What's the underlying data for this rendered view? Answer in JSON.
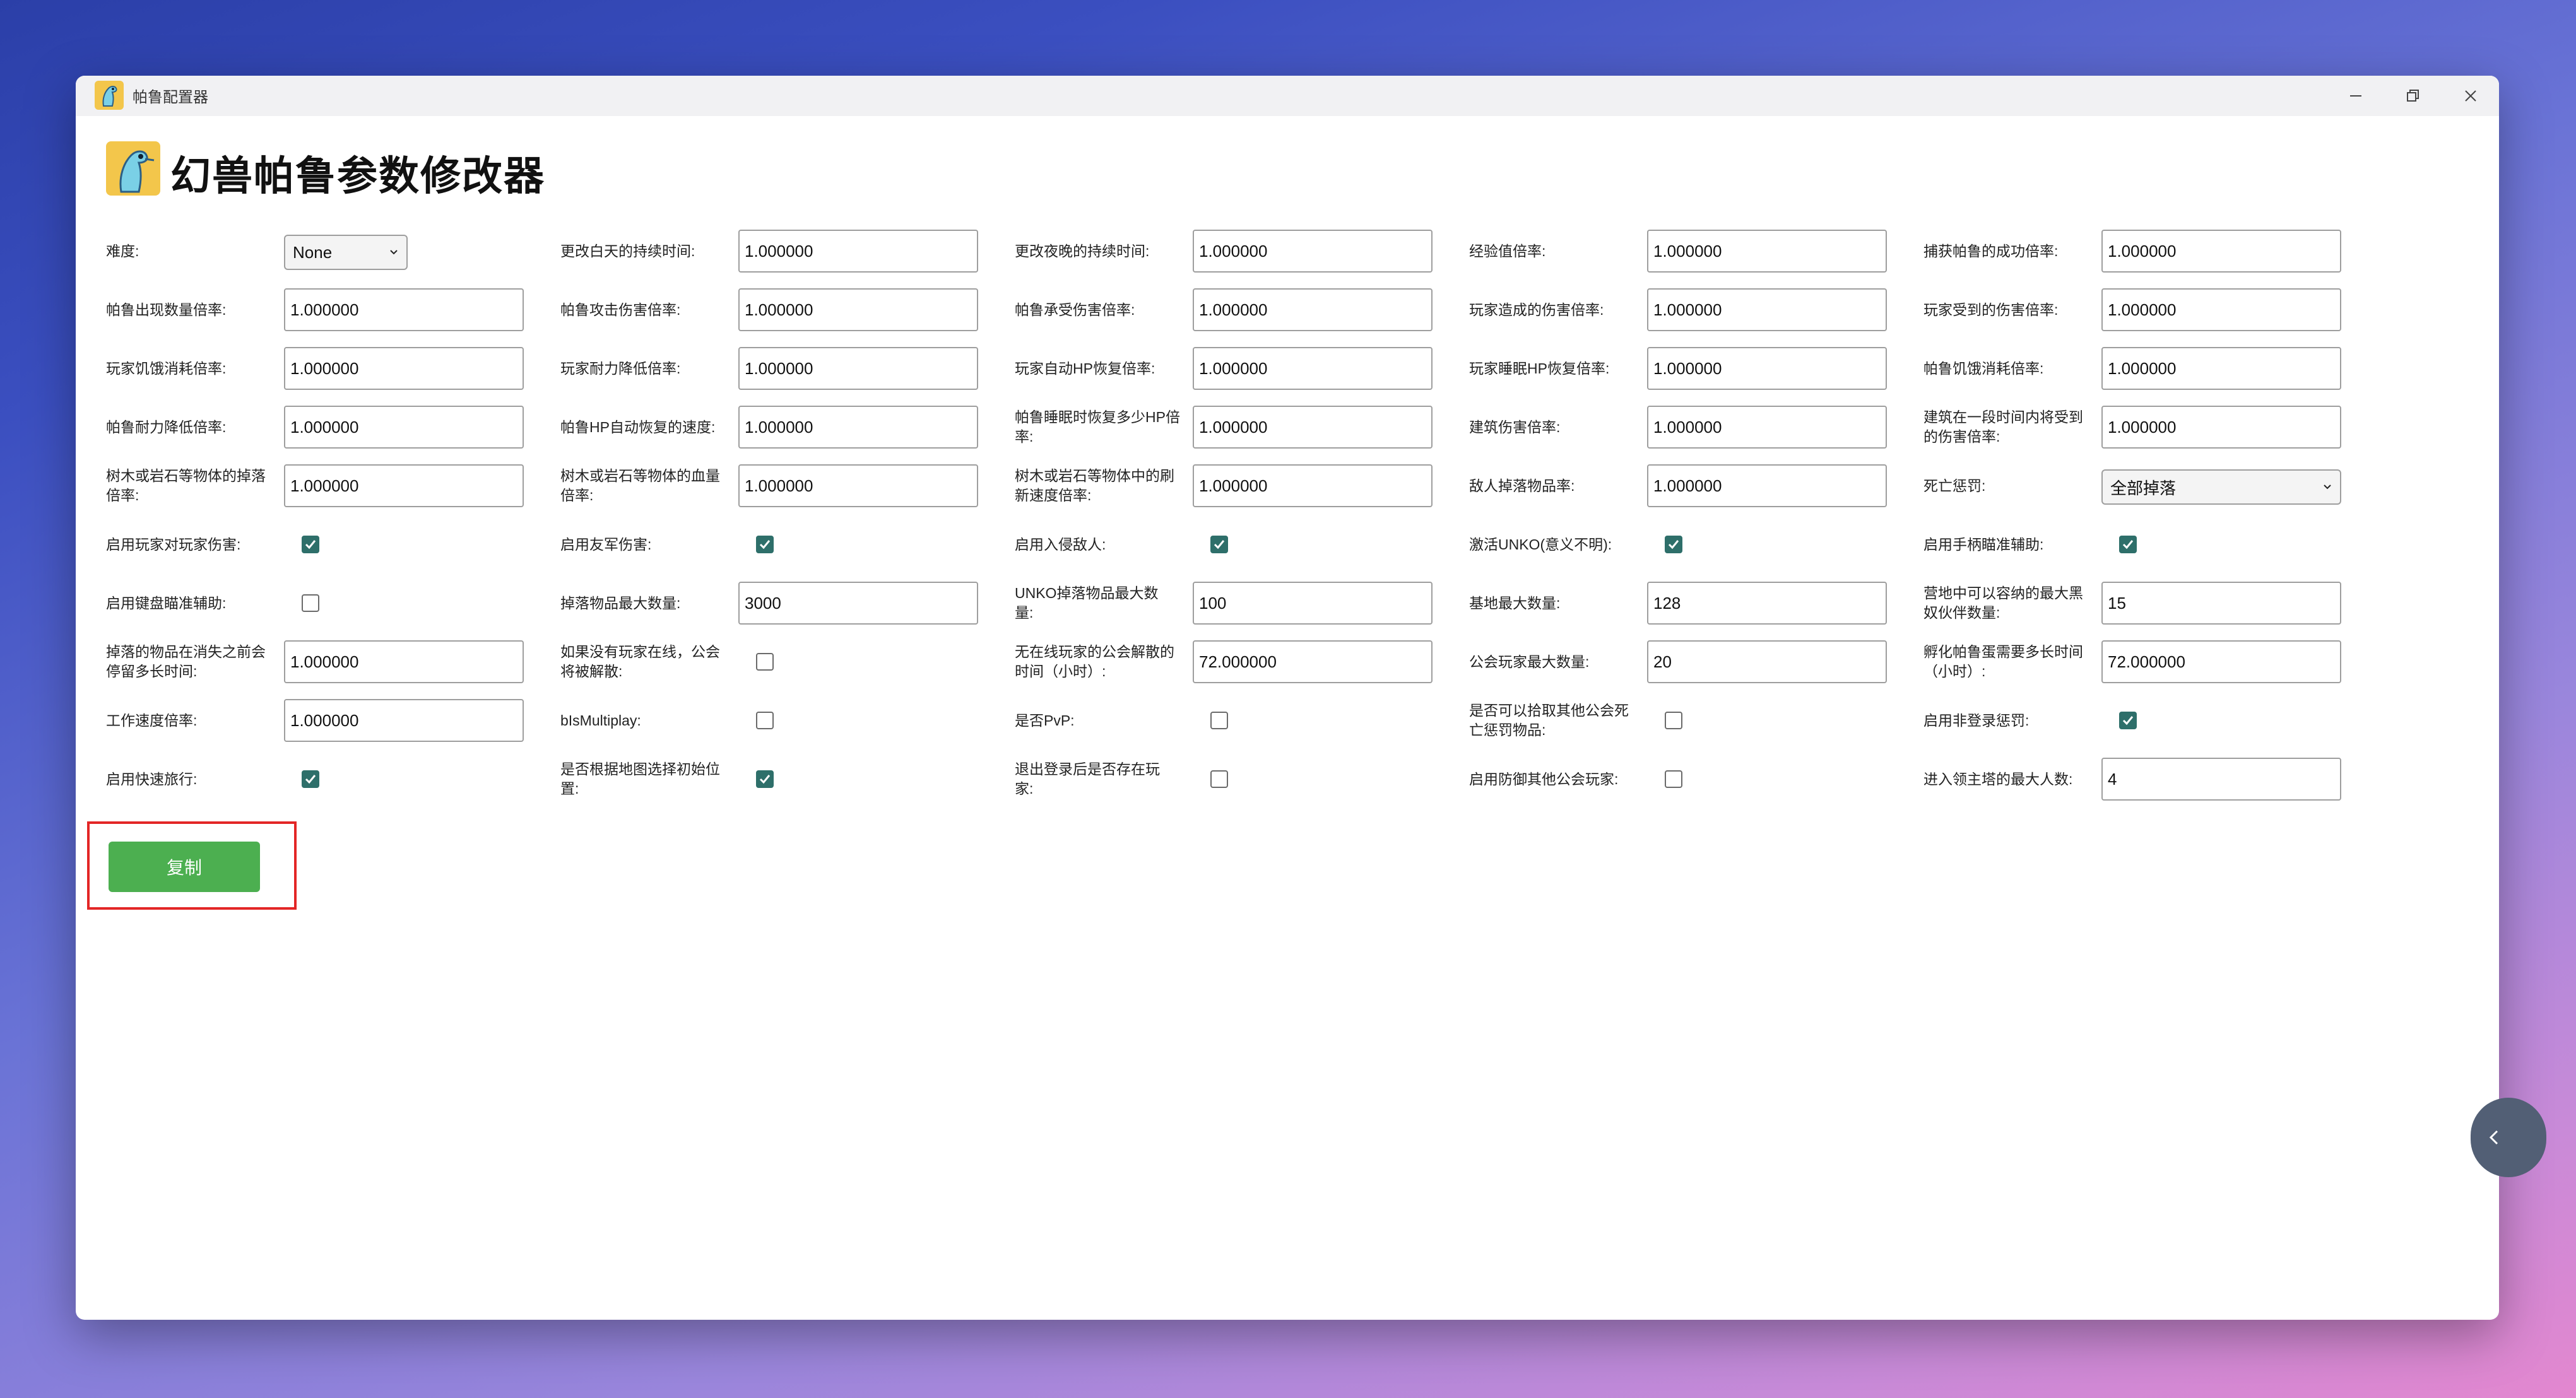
{
  "window": {
    "title": "帕鲁配置器"
  },
  "header": {
    "title": "幻兽帕鲁参数修改器"
  },
  "rows": [
    [
      {
        "label": "难度:",
        "type": "select",
        "value": "None"
      },
      {
        "label": "更改白天的持续时间:",
        "type": "text",
        "value": "1.000000"
      },
      {
        "label": "更改夜晚的持续时间:",
        "type": "text",
        "value": "1.000000"
      },
      {
        "label": "经验值倍率:",
        "type": "text",
        "value": "1.000000"
      },
      {
        "label": "捕获帕鲁的成功倍率:",
        "type": "text",
        "value": "1.000000"
      }
    ],
    [
      {
        "label": "帕鲁出现数量倍率:",
        "type": "text",
        "value": "1.000000"
      },
      {
        "label": "帕鲁攻击伤害倍率:",
        "type": "text",
        "value": "1.000000"
      },
      {
        "label": "帕鲁承受伤害倍率:",
        "type": "text",
        "value": "1.000000"
      },
      {
        "label": "玩家造成的伤害倍率:",
        "type": "text",
        "value": "1.000000"
      },
      {
        "label": "玩家受到的伤害倍率:",
        "type": "text",
        "value": "1.000000"
      }
    ],
    [
      {
        "label": "玩家饥饿消耗倍率:",
        "type": "text",
        "value": "1.000000"
      },
      {
        "label": "玩家耐力降低倍率:",
        "type": "text",
        "value": "1.000000"
      },
      {
        "label": "玩家自动HP恢复倍率:",
        "type": "text",
        "value": "1.000000"
      },
      {
        "label": "玩家睡眠HP恢复倍率:",
        "type": "text",
        "value": "1.000000"
      },
      {
        "label": "帕鲁饥饿消耗倍率:",
        "type": "text",
        "value": "1.000000"
      }
    ],
    [
      {
        "label": "帕鲁耐力降低倍率:",
        "type": "text",
        "value": "1.000000"
      },
      {
        "label": "帕鲁HP自动恢复的速度:",
        "type": "text",
        "value": "1.000000"
      },
      {
        "label": [
          "帕鲁睡眠时恢复多少HP倍",
          "率:"
        ],
        "type": "text",
        "value": "1.000000"
      },
      {
        "label": "建筑伤害倍率:",
        "type": "text",
        "value": "1.000000"
      },
      {
        "label": [
          "建筑在一段时间内将受到",
          "的伤害倍率:"
        ],
        "type": "text",
        "value": "1.000000"
      }
    ],
    [
      {
        "label": [
          "树木或岩石等物体的掉落",
          "倍率:"
        ],
        "type": "text",
        "value": "1.000000"
      },
      {
        "label": [
          "树木或岩石等物体的血量",
          "倍率:"
        ],
        "type": "text",
        "value": "1.000000"
      },
      {
        "label": [
          "树木或岩石等物体中的刷",
          "新速度倍率:"
        ],
        "type": "text",
        "value": "1.000000"
      },
      {
        "label": "敌人掉落物品率:",
        "type": "text",
        "value": "1.000000"
      },
      {
        "label": "死亡惩罚:",
        "type": "select",
        "value": "全部掉落"
      }
    ],
    [
      {
        "label": "启用玩家对玩家伤害:",
        "type": "check",
        "checked": true
      },
      {
        "label": "启用友军伤害:",
        "type": "check",
        "checked": true
      },
      {
        "label": "启用入侵敌人:",
        "type": "check",
        "checked": true
      },
      {
        "label": "激活UNKO(意义不明):",
        "type": "check",
        "checked": true
      },
      {
        "label": "启用手柄瞄准辅助:",
        "type": "check",
        "checked": true
      }
    ],
    [
      {
        "label": "启用键盘瞄准辅助:",
        "type": "check",
        "checked": false
      },
      {
        "label": "掉落物品最大数量:",
        "type": "text",
        "value": "3000"
      },
      {
        "label": [
          "UNKO掉落物品最大数",
          "量:"
        ],
        "type": "text",
        "value": "100"
      },
      {
        "label": "基地最大数量:",
        "type": "text",
        "value": "128"
      },
      {
        "label": [
          "营地中可以容纳的最大黑",
          "奴伙伴数量:"
        ],
        "type": "text",
        "value": "15"
      }
    ],
    [
      {
        "label": [
          "掉落的物品在消失之前会",
          "停留多长时间:"
        ],
        "type": "text",
        "value": "1.000000"
      },
      {
        "label": [
          "如果没有玩家在线，公会",
          "将被解散:"
        ],
        "type": "check",
        "checked": false
      },
      {
        "label": [
          "无在线玩家的公会解散的",
          "时间（小时）:"
        ],
        "type": "text",
        "value": "72.000000"
      },
      {
        "label": "公会玩家最大数量:",
        "type": "text",
        "value": "20"
      },
      {
        "label": [
          "孵化帕鲁蛋需要多长时间",
          "（小时）:"
        ],
        "type": "text",
        "value": "72.000000"
      }
    ],
    [
      {
        "label": "工作速度倍率:",
        "type": "text",
        "value": "1.000000"
      },
      {
        "label": "bIsMultiplay:",
        "type": "check",
        "checked": false
      },
      {
        "label": "是否PvP:",
        "type": "check",
        "checked": false
      },
      {
        "label": [
          "是否可以拾取其他公会死",
          "亡惩罚物品:"
        ],
        "type": "check",
        "checked": false
      },
      {
        "label": "启用非登录惩罚:",
        "type": "check",
        "checked": true
      }
    ],
    [
      {
        "label": "启用快速旅行:",
        "type": "check",
        "checked": true
      },
      {
        "label": [
          "是否根据地图选择初始位",
          "置:"
        ],
        "type": "check",
        "checked": true
      },
      {
        "label": [
          "退出登录后是否存在玩",
          "家:"
        ],
        "type": "check",
        "checked": false
      },
      {
        "label": "启用防御其他公会玩家:",
        "type": "check",
        "checked": false
      },
      {
        "label": "进入领主塔的最大人数:",
        "type": "text",
        "value": "4"
      }
    ]
  ],
  "actions": {
    "copy_label": "复制"
  }
}
